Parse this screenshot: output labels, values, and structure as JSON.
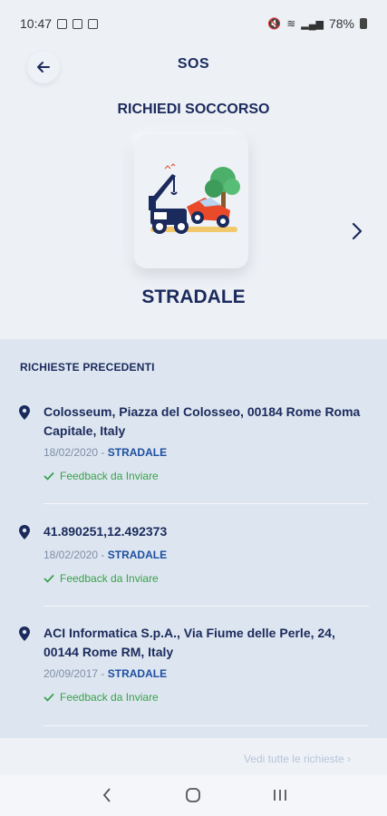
{
  "status": {
    "time": "10:47",
    "battery": "78%"
  },
  "header": {
    "title": "SOS"
  },
  "request": {
    "title": "RICHIEDI SOCCORSO",
    "type_label": "STRADALE"
  },
  "history": {
    "title": "RICHIESTE PRECEDENTI",
    "items": [
      {
        "address": "Colosseum, Piazza del Colosseo, 00184 Rome Roma Capitale, Italy",
        "date": "18/02/2020",
        "type": "STRADALE",
        "feedback": "Feedback da Inviare"
      },
      {
        "address": "41.890251,12.492373",
        "date": "18/02/2020",
        "type": "STRADALE",
        "feedback": "Feedback da Inviare"
      },
      {
        "address": "ACI Informatica S.p.A., Via Fiume delle Perle, 24, 00144 Rome RM, Italy",
        "date": "20/09/2017",
        "type": "STRADALE",
        "feedback": "Feedback da Inviare"
      }
    ],
    "see_all": "Vedi tutte le richieste ›"
  },
  "colors": {
    "primary": "#1b2a5c",
    "accent_blue": "#1e4fa0",
    "success": "#3aa14a",
    "panel_bg": "#dde6f0"
  },
  "icons": {
    "back": "arrow-left-icon",
    "next": "chevron-right-icon",
    "pin": "location-pin-icon",
    "check": "check-icon"
  }
}
